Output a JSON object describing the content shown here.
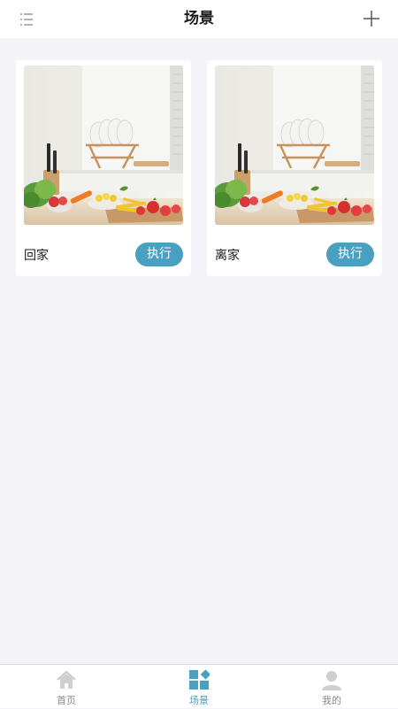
{
  "header": {
    "title": "场景",
    "menu_icon": "menu-list-icon",
    "add_icon": "plus-icon"
  },
  "scenes": [
    {
      "name": "回家",
      "action_label": "执行",
      "image": "kitchen-vegetables-photo"
    },
    {
      "name": "离家",
      "action_label": "执行",
      "image": "kitchen-vegetables-photo"
    }
  ],
  "tabbar": {
    "tabs": [
      {
        "label": "首页",
        "icon": "home-icon",
        "active": false
      },
      {
        "label": "场景",
        "icon": "scene-grid-icon",
        "active": true
      },
      {
        "label": "我的",
        "icon": "user-icon",
        "active": false
      }
    ]
  },
  "colors": {
    "accent": "#4aa0c1",
    "background": "#f4f3f7",
    "inactive_tab": "#8a8a8a"
  }
}
